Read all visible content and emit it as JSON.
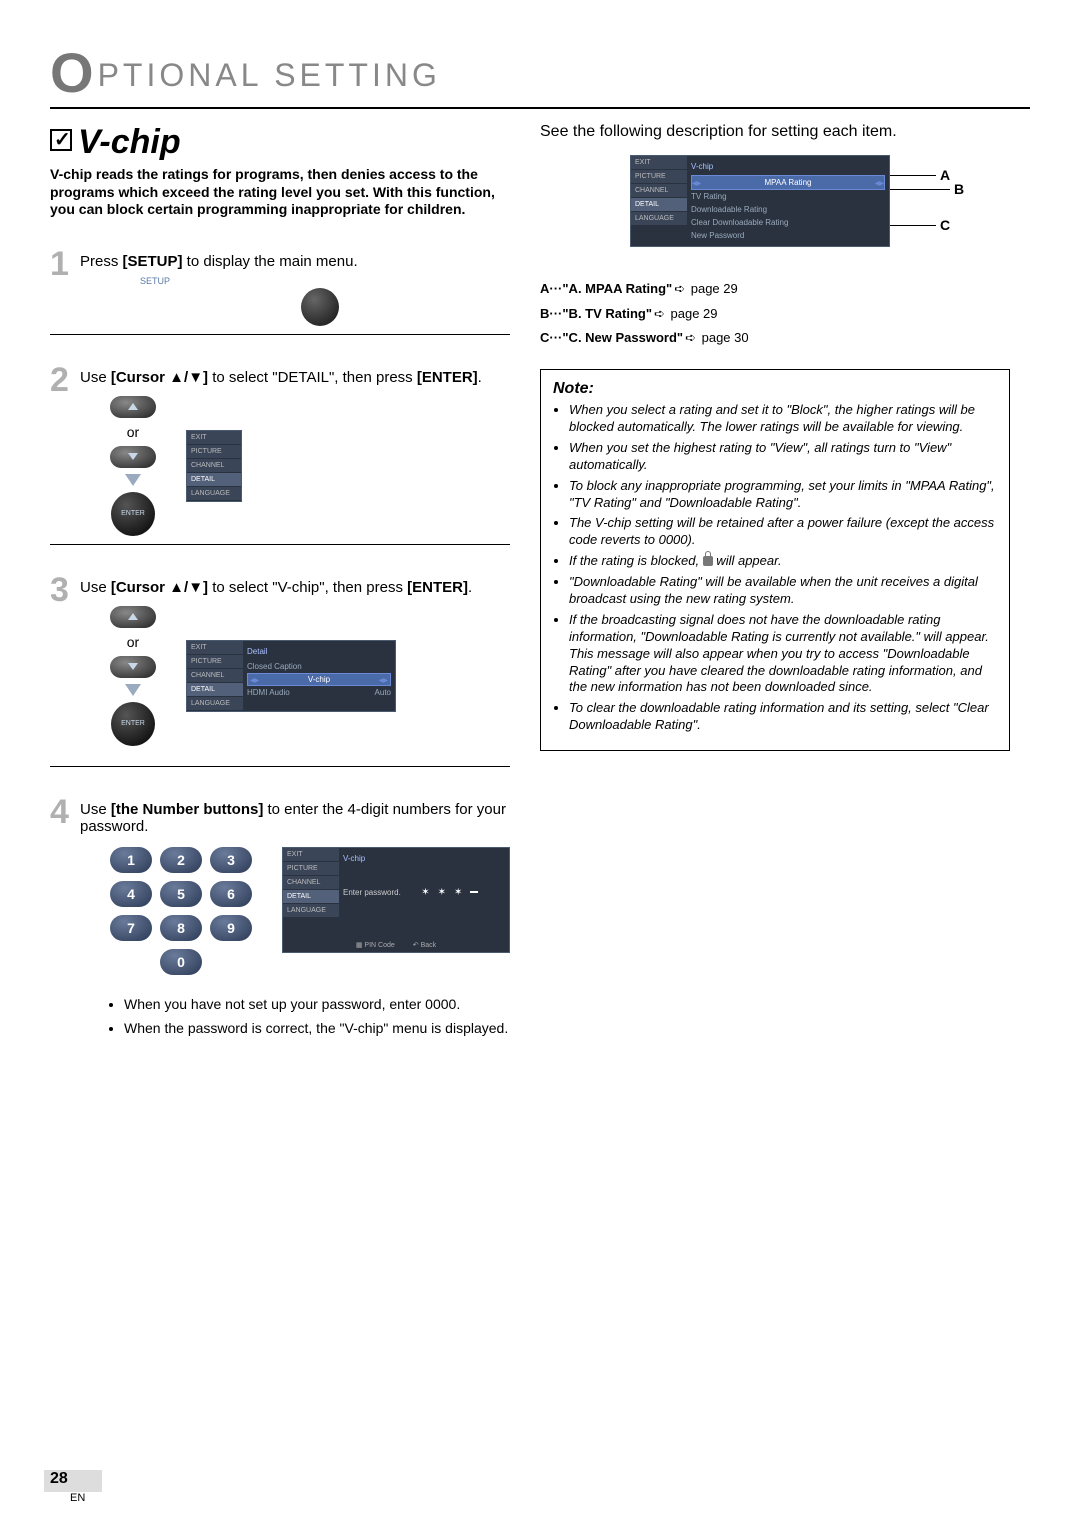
{
  "header": "PTIONAL SETTING",
  "section_title": "V-chip",
  "intro": "V-chip reads the ratings for programs, then denies access to the programs which exceed the rating level you set. With this function, you can block certain programming inappropriate for children.",
  "steps": {
    "s1": {
      "num": "1",
      "text_a": "Press ",
      "bold": "[SETUP]",
      "text_b": " to display the main menu.",
      "setup_label": "SETUP"
    },
    "s2": {
      "num": "2",
      "text_a": "Use ",
      "bold": "[Cursor ▲/▼]",
      "text_b": " to select \"DETAIL\", then press ",
      "bold2": "[ENTER]",
      "dot": ".",
      "or": "or",
      "enter": "ENTER"
    },
    "s3": {
      "num": "3",
      "text_a": "Use ",
      "bold": "[Cursor ▲/▼]",
      "text_b": " to select \"V-chip\", then press ",
      "bold2": "[ENTER]",
      "dot": ".",
      "or": "or",
      "enter": "ENTER"
    },
    "s4": {
      "num": "4",
      "text_a": "Use ",
      "bold": "[the Number buttons]",
      "text_b": " to enter the 4-digit numbers for your password."
    }
  },
  "osd_sidebar": [
    "EXIT",
    "PICTURE",
    "CHANNEL",
    "DETAIL",
    "LANGUAGE"
  ],
  "osd_detail": {
    "head": "Detail",
    "rows": [
      "Closed Caption",
      "V-chip",
      "HDMI Audio"
    ],
    "auto": "Auto"
  },
  "osd_vchip_pw": {
    "head": "V-chip",
    "enter": "Enter password.",
    "pin": "PIN Code",
    "back": "Back"
  },
  "osd_vchip_menu": {
    "head": "V-chip",
    "rows": [
      "MPAA Rating",
      "TV Rating",
      "Downloadable Rating",
      "Clear Downloadable Rating",
      "New Password"
    ]
  },
  "keypad": [
    "1",
    "2",
    "3",
    "4",
    "5",
    "6",
    "7",
    "8",
    "9",
    "0"
  ],
  "post_bullets": [
    "When you have not set up your password, enter 0000.",
    "When the password is correct, the \"V-chip\" menu is displayed."
  ],
  "right_intro": "See the following description for setting each item.",
  "labels": {
    "A": "A",
    "B": "B",
    "C": "C"
  },
  "refs": {
    "a_pre": "A···",
    "a_bold": "\"A. MPAA Rating\"",
    "a_post": " page 29",
    "b_pre": "B···",
    "b_bold": "\"B. TV Rating\"",
    "b_post": " page 29",
    "c_pre": "C···",
    "c_bold": "\"C. New Password\"",
    "c_post": "  page 30"
  },
  "note_title": "Note:",
  "notes": [
    "When you select a rating and set it to \"Block\", the higher ratings will be blocked automatically. The lower ratings will be available for viewing.",
    "When you set the highest rating to \"View\", all ratings turn to \"View\" automatically.",
    "To block any inappropriate programming, set your limits in \"MPAA Rating\", \"TV Rating\" and \"Downloadable Rating\".",
    "The V-chip setting will be retained after a power failure (except the access code reverts to 0000).",
    "If the rating is blocked, __LOCK__ will appear.",
    "\"Downloadable Rating\" will be available when the unit receives a digital broadcast using the new rating system.",
    "If the broadcasting signal does not have the downloadable rating information, \"Downloadable Rating is currently not available.\" will appear.\nThis message will also appear when you try to access \"Downloadable Rating\" after you have cleared the downloadable rating information, and the new information has not been downloaded since.",
    "To clear the downloadable rating information and its setting, select \"Clear Downloadable Rating\"."
  ],
  "page": "28",
  "page_sub": "EN"
}
